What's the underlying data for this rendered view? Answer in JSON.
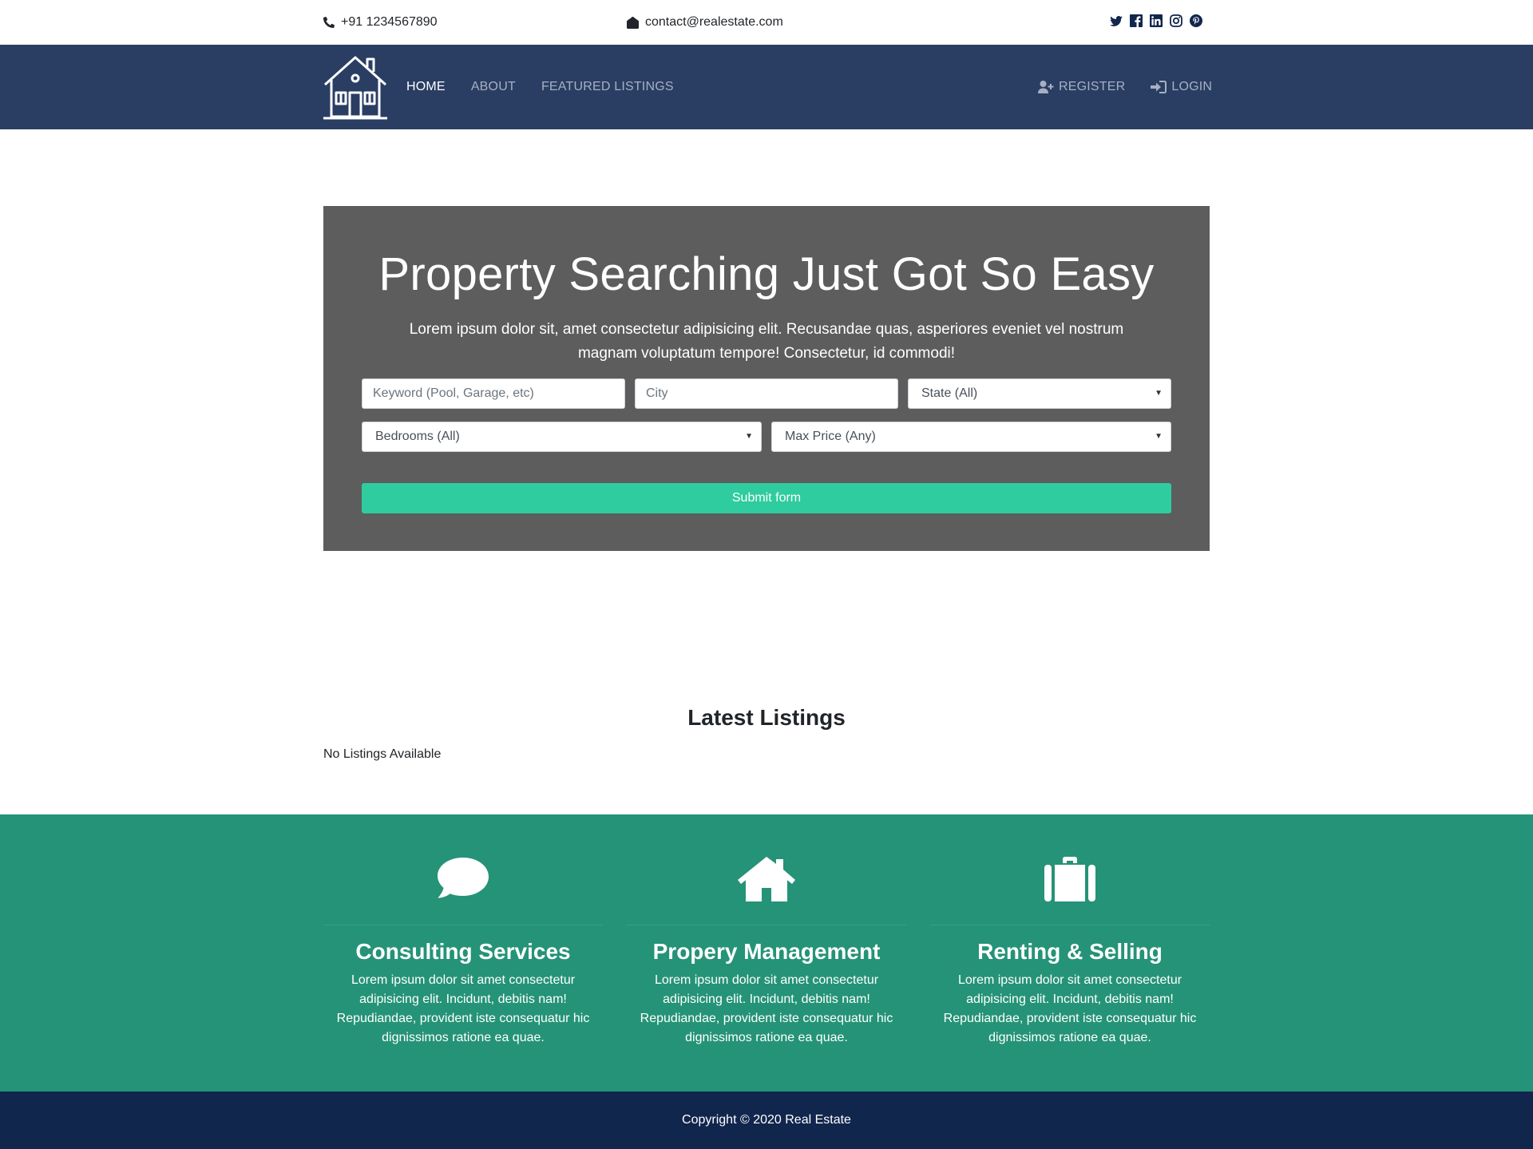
{
  "topbar": {
    "phone": "+91 1234567890",
    "email": "contact@realestate.com",
    "social_icons": [
      "twitter-icon",
      "facebook-icon",
      "linkedin-icon",
      "instagram-icon",
      "pinterest-icon"
    ]
  },
  "nav": {
    "items": [
      {
        "label": "HOME",
        "active": true
      },
      {
        "label": "ABOUT",
        "active": false
      },
      {
        "label": "FEATURED LISTINGS",
        "active": false
      }
    ],
    "register_label": "REGISTER",
    "login_label": "LOGIN"
  },
  "hero": {
    "title": "Property Searching Just Got So Easy",
    "lead": "Lorem ipsum dolor sit, amet consectetur adipisicing elit. Recusandae quas, asperiores eveniet vel nostrum magnam voluptatum tempore! Consectetur, id commodi!",
    "keyword_placeholder": "Keyword (Pool, Garage, etc)",
    "city_placeholder": "City",
    "state_selected": "State (All)",
    "bedrooms_selected": "Bedrooms (All)",
    "price_selected": "Max Price (Any)",
    "submit_label": "Submit form"
  },
  "latest": {
    "title": "Latest Listings",
    "empty_message": "No Listings Available"
  },
  "services": [
    {
      "icon": "comment-icon",
      "title": "Consulting Services",
      "text": "Lorem ipsum dolor sit amet consectetur adipisicing elit. Incidunt, debitis nam! Repudiandae, provident iste consequatur hic dignissimos ratione ea quae."
    },
    {
      "icon": "home-icon",
      "title": "Propery Management",
      "text": "Lorem ipsum dolor sit amet consectetur adipisicing elit. Incidunt, debitis nam! Repudiandae, provident iste consequatur hic dignissimos ratione ea quae."
    },
    {
      "icon": "suitcase-icon",
      "title": "Renting & Selling",
      "text": "Lorem ipsum dolor sit amet consectetur adipisicing elit. Incidunt, debitis nam! Repudiandae, provident iste consequatur hic dignissimos ratione ea quae."
    }
  ],
  "footer": {
    "copyright": "Copyright © 2020 Real Estate"
  },
  "colors": {
    "navbar": "#2a3e63",
    "hero_bg": "#5d5d5d",
    "submit": "#2ecc9e",
    "services_bg": "#259377",
    "footer_bg": "#11264d"
  }
}
